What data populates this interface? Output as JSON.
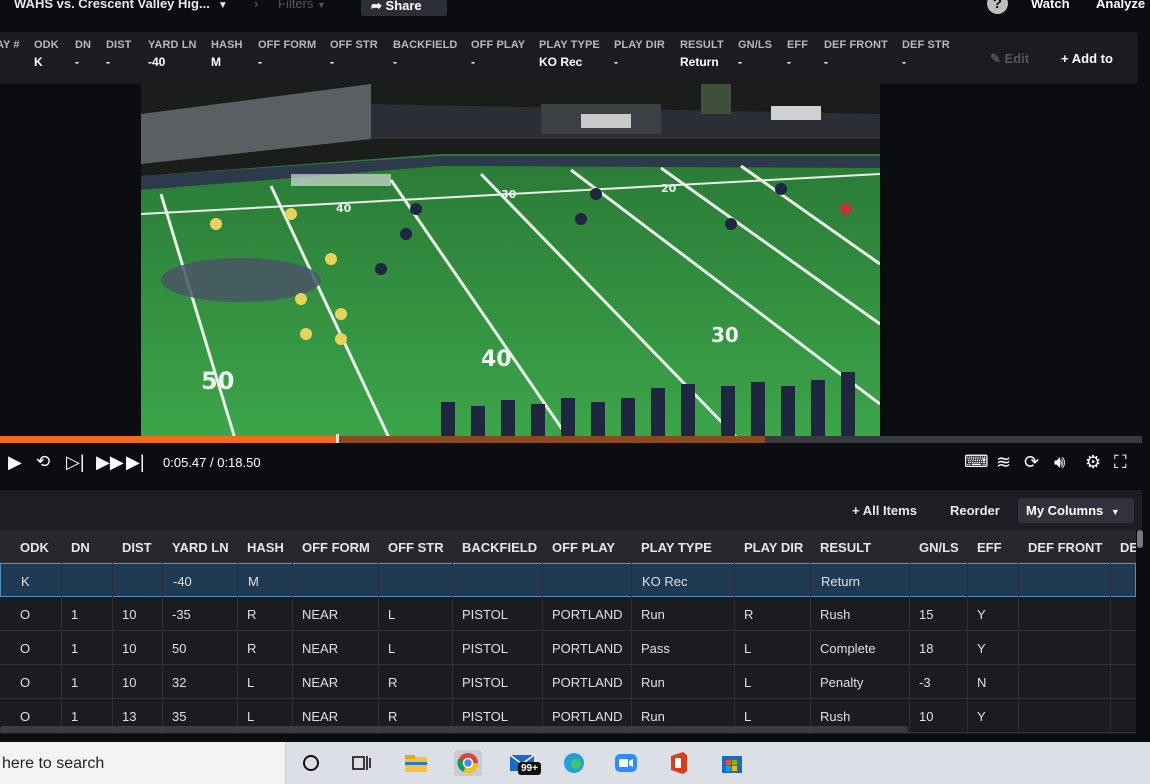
{
  "topbar": {
    "title": "WAHS vs. Crescent Valley Hig...",
    "filters": "Filters",
    "share": "Share",
    "watch": "Watch",
    "analyze": "Analyze"
  },
  "playbar": {
    "columns": [
      {
        "h": "AY #",
        "v": ""
      },
      {
        "h": "ODK",
        "v": "K"
      },
      {
        "h": "DN",
        "v": "-"
      },
      {
        "h": "DIST",
        "v": "-"
      },
      {
        "h": "YARD LN",
        "v": "-40"
      },
      {
        "h": "HASH",
        "v": "M"
      },
      {
        "h": "OFF FORM",
        "v": "-"
      },
      {
        "h": "OFF STR",
        "v": "-"
      },
      {
        "h": "BACKFIELD",
        "v": "-"
      },
      {
        "h": "OFF PLAY",
        "v": "-"
      },
      {
        "h": "PLAY TYPE",
        "v": "KO Rec"
      },
      {
        "h": "PLAY DIR",
        "v": "-"
      },
      {
        "h": "RESULT",
        "v": "Return"
      },
      {
        "h": "GN/LS",
        "v": "-"
      },
      {
        "h": "EFF",
        "v": "-"
      },
      {
        "h": "DEF FRONT",
        "v": "-"
      },
      {
        "h": "DEF STR",
        "v": "-"
      }
    ],
    "edit": "Edit",
    "add_to": "Add to"
  },
  "player": {
    "time": "0:05.47 / 0:18.50",
    "progress_fraction": 0.296,
    "buffered_fraction": 0.67
  },
  "field_numbers": [
    "50",
    "40",
    "30",
    "40",
    "30",
    "20"
  ],
  "table_toolbar": {
    "all_items": "All Items",
    "reorder": "Reorder",
    "my_columns": "My Columns"
  },
  "table": {
    "headers": [
      "ODK",
      "DN",
      "DIST",
      "YARD LN",
      "HASH",
      "OFF FORM",
      "OFF STR",
      "BACKFIELD",
      "OFF PLAY",
      "PLAY TYPE",
      "PLAY DIR",
      "RESULT",
      "GN/LS",
      "EFF",
      "DEF FRONT",
      "DE"
    ],
    "rows": [
      [
        "K",
        "",
        "",
        "-40",
        "M",
        "",
        "",
        "",
        "",
        "KO Rec",
        "",
        "Return",
        "",
        "",
        "",
        ""
      ],
      [
        "O",
        "1",
        "10",
        "-35",
        "R",
        "NEAR",
        "L",
        "PISTOL",
        "PORTLAND",
        "Run",
        "R",
        "Rush",
        "15",
        "Y",
        "",
        ""
      ],
      [
        "O",
        "1",
        "10",
        "50",
        "R",
        "NEAR",
        "L",
        "PISTOL",
        "PORTLAND",
        "Pass",
        "L",
        "Complete",
        "18",
        "Y",
        "",
        ""
      ],
      [
        "O",
        "1",
        "10",
        "32",
        "L",
        "NEAR",
        "R",
        "PISTOL",
        "PORTLAND",
        "Run",
        "L",
        "Penalty",
        "-3",
        "N",
        "",
        ""
      ],
      [
        "O",
        "1",
        "13",
        "35",
        "L",
        "NEAR",
        "R",
        "PISTOL",
        "PORTLAND",
        "Run",
        "L",
        "Rush",
        "10",
        "Y",
        "",
        ""
      ]
    ]
  },
  "taskbar": {
    "search_text": "here to search",
    "mail_badge": "99+"
  },
  "colors": {
    "accent": "#f26a1b",
    "selected_row": "#1f3a52",
    "selected_border": "#4e8fc6"
  }
}
